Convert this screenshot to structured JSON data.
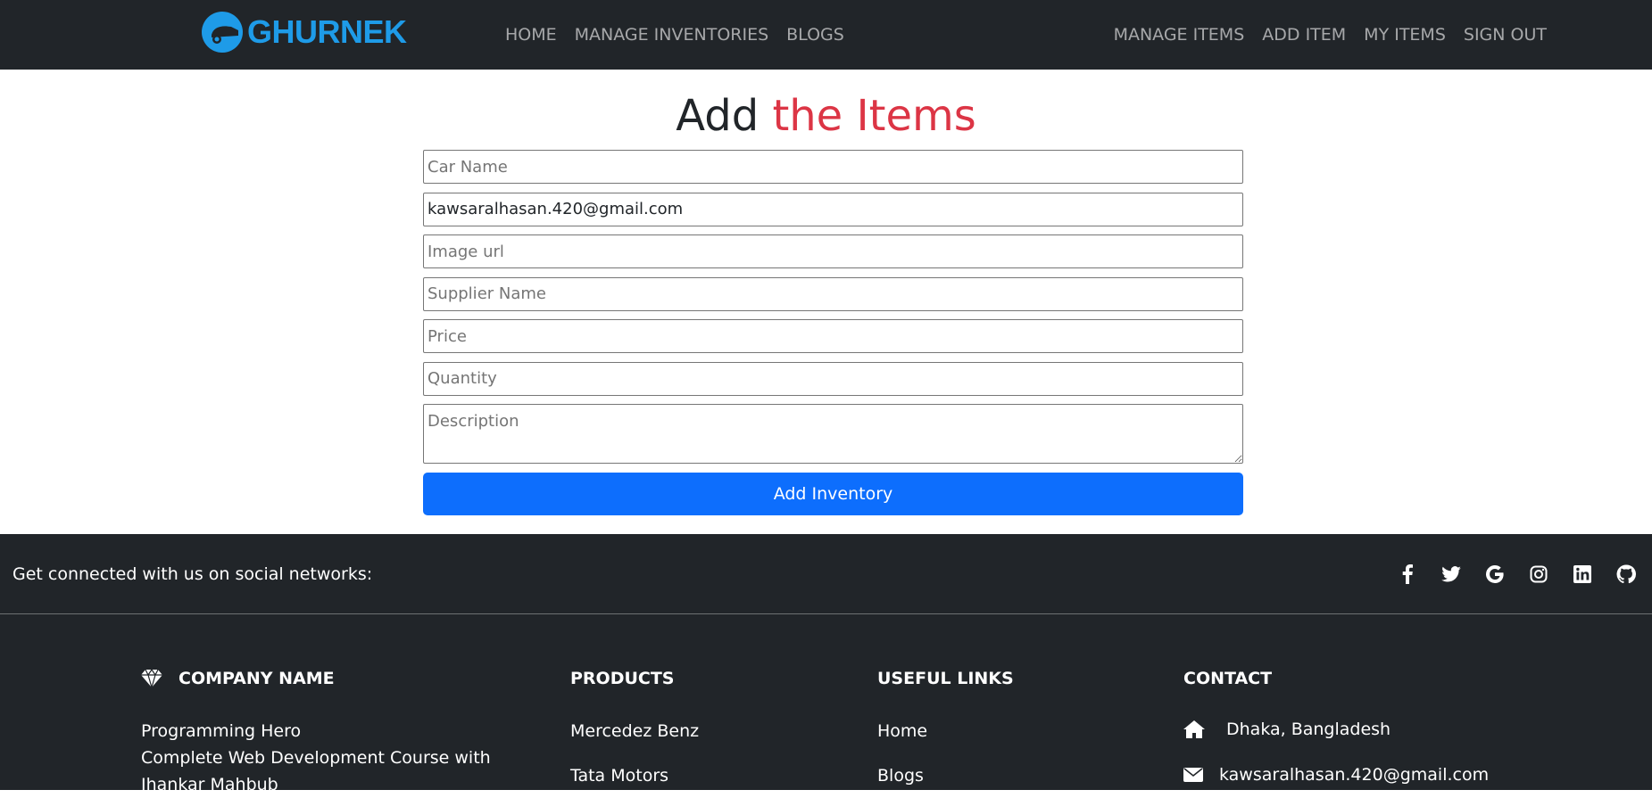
{
  "navbar": {
    "brand": "GHURNEK",
    "left_links": [
      "HOME",
      "MANAGE INVENTORIES",
      "BLOGS"
    ],
    "right_links": [
      "MANAGE ITEMS",
      "ADD ITEM",
      "MY ITEMS",
      "SIGN OUT"
    ]
  },
  "main": {
    "title_prefix": "Add ",
    "title_accent": "the Items",
    "form": {
      "car_name_placeholder": "Car Name",
      "email_value": "kawsaralhasan.420@gmail.com",
      "image_url_placeholder": "Image url",
      "supplier_placeholder": "Supplier Name",
      "price_placeholder": "Price",
      "quantity_placeholder": "Quantity",
      "description_placeholder": "Description",
      "submit_label": "Add Inventory"
    }
  },
  "footer": {
    "social_text": "Get connected with us on social networks:",
    "social_icons": [
      "facebook-icon",
      "twitter-icon",
      "google-icon",
      "instagram-icon",
      "linkedin-icon",
      "github-icon"
    ],
    "company": {
      "title": "COMPANY NAME",
      "lines": [
        "Programming Hero",
        "Complete Web Development Course with",
        "Jhankar Mahbub"
      ]
    },
    "products": {
      "title": "PRODUCTS",
      "items": [
        "Mercedez Benz",
        "Tata Motors"
      ]
    },
    "useful_links": {
      "title": "USEFUL LINKS",
      "items": [
        "Home",
        "Blogs"
      ]
    },
    "contact": {
      "title": "CONTACT",
      "address": "Dhaka, Bangladesh",
      "email": "kawsaralhasan.420@gmail.com"
    }
  },
  "colors": {
    "navbar_bg": "#212529",
    "brand": "#1e9be8",
    "accent": "#dc3545",
    "primary_button": "#0d6efd"
  }
}
